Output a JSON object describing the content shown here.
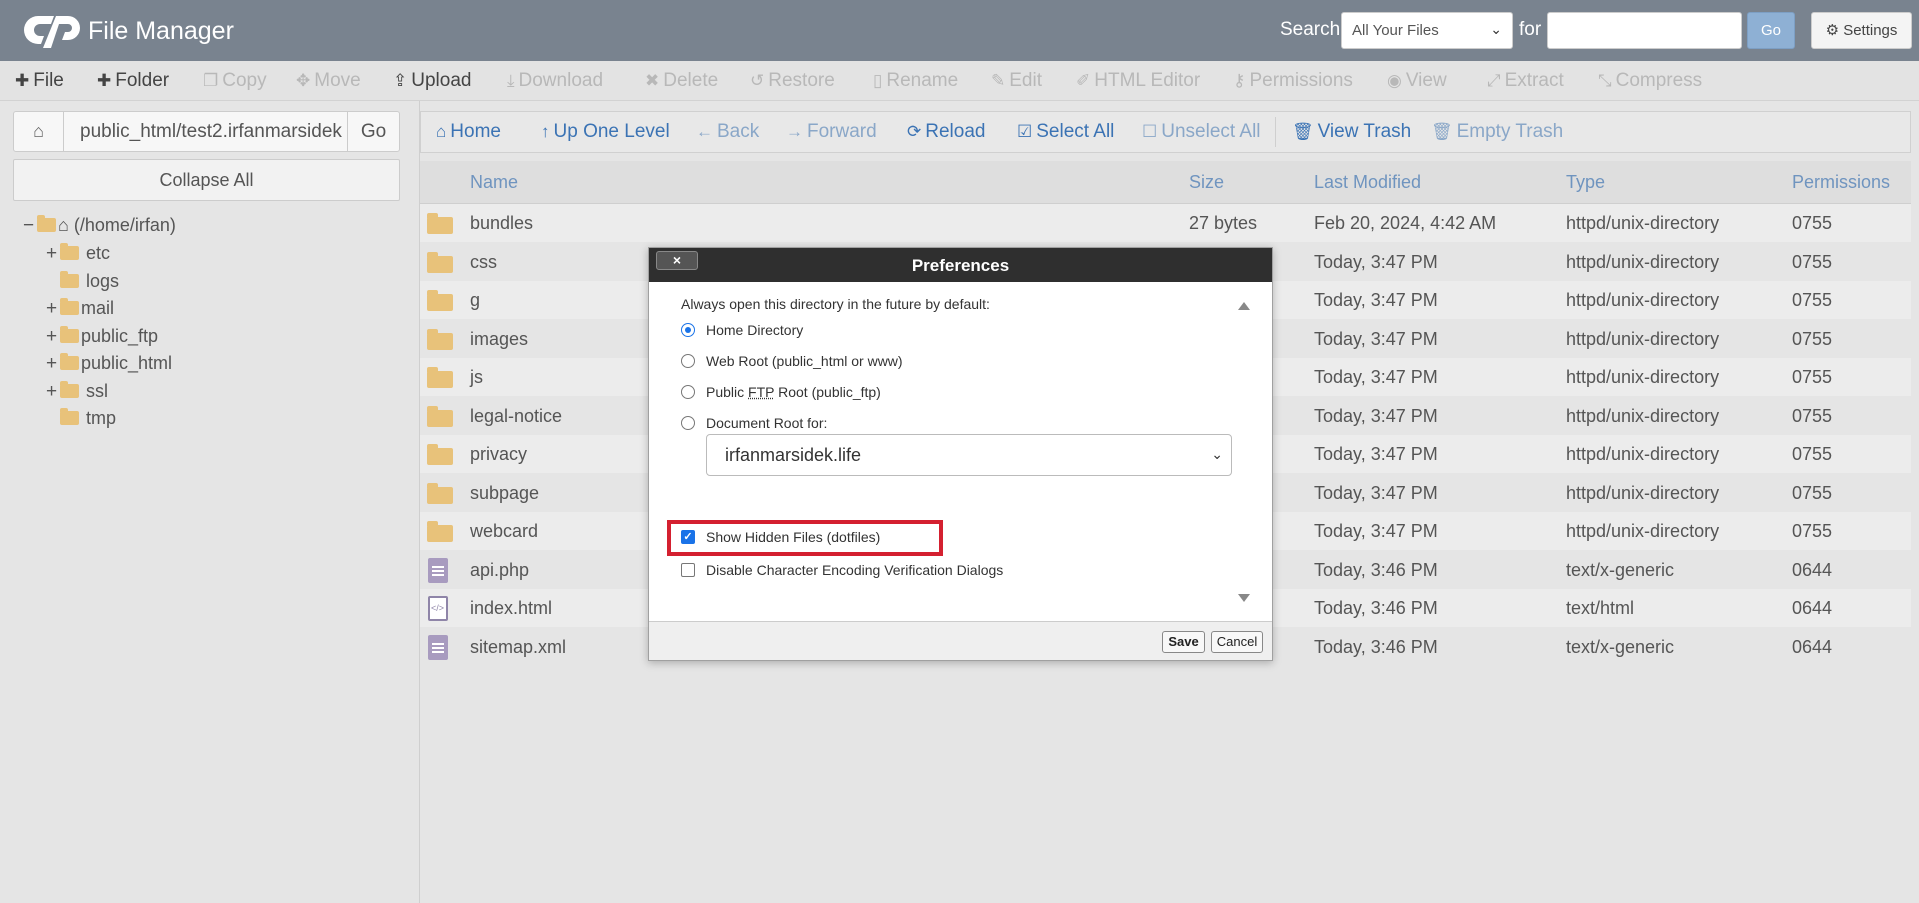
{
  "header": {
    "app_title": "File Manager",
    "search_label": "Search",
    "search_scope": "All Your Files",
    "for_label": "for",
    "search_value": "",
    "go_label": "Go",
    "settings_label": "Settings"
  },
  "toolbar": {
    "file": "File",
    "folder": "Folder",
    "copy": "Copy",
    "move": "Move",
    "upload": "Upload",
    "download": "Download",
    "delete": "Delete",
    "restore": "Restore",
    "rename": "Rename",
    "edit": "Edit",
    "html_editor": "HTML Editor",
    "permissions": "Permissions",
    "view": "View",
    "extract": "Extract",
    "compress": "Compress"
  },
  "left": {
    "path": "public_html/test2.irfanmarsidek",
    "go_label": "Go",
    "collapse_label": "Collapse All",
    "tree_root": "(/home/irfan)",
    "tree": [
      "etc",
      "logs",
      "mail",
      "public_ftp",
      "public_html",
      "ssl",
      "tmp"
    ]
  },
  "nav": {
    "home": "Home",
    "up": "Up One Level",
    "back": "Back",
    "forward": "Forward",
    "reload": "Reload",
    "select_all": "Select All",
    "unselect_all": "Unselect All",
    "view_trash": "View Trash",
    "empty_trash": "Empty Trash"
  },
  "table": {
    "headers": {
      "name": "Name",
      "size": "Size",
      "modified": "Last Modified",
      "type": "Type",
      "perms": "Permissions"
    },
    "rows": [
      {
        "name": "bundles",
        "size": "27 bytes",
        "modified": "Feb 20, 2024, 4:42 AM",
        "type": "httpd/unix-directory",
        "perms": "0755"
      },
      {
        "name": "css",
        "size": "",
        "modified": "Today, 3:47 PM",
        "type": "httpd/unix-directory",
        "perms": "0755"
      },
      {
        "name": "g",
        "size": "",
        "modified": "Today, 3:47 PM",
        "type": "httpd/unix-directory",
        "perms": "0755"
      },
      {
        "name": "images",
        "size": "",
        "modified": "Today, 3:47 PM",
        "type": "httpd/unix-directory",
        "perms": "0755"
      },
      {
        "name": "js",
        "size": "",
        "modified": "Today, 3:47 PM",
        "type": "httpd/unix-directory",
        "perms": "0755"
      },
      {
        "name": "legal-notice",
        "size": "",
        "modified": "Today, 3:47 PM",
        "type": "httpd/unix-directory",
        "perms": "0755"
      },
      {
        "name": "privacy",
        "size": "",
        "modified": "Today, 3:47 PM",
        "type": "httpd/unix-directory",
        "perms": "0755"
      },
      {
        "name": "subpage",
        "size": "",
        "modified": "Today, 3:47 PM",
        "type": "httpd/unix-directory",
        "perms": "0755"
      },
      {
        "name": "webcard",
        "size": "",
        "modified": "Today, 3:47 PM",
        "type": "httpd/unix-directory",
        "perms": "0755"
      },
      {
        "name": "api.php",
        "size": "",
        "modified": "Today, 3:46 PM",
        "type": "text/x-generic",
        "perms": "0644"
      },
      {
        "name": "index.html",
        "size": "",
        "modified": "Today, 3:46 PM",
        "type": "text/html",
        "perms": "0644"
      },
      {
        "name": "sitemap.xml",
        "size": "",
        "modified": "Today, 3:46 PM",
        "type": "text/x-generic",
        "perms": "0644"
      }
    ]
  },
  "dialog": {
    "close_label": "×",
    "title": "Preferences",
    "intro": "Always open this directory in the future by default:",
    "opt_home": "Home Directory",
    "opt_webroot": "Web Root (public_html or www)",
    "opt_ftp_pre": "Public ",
    "opt_ftp_abbr": "FTP",
    "opt_ftp_post": " Root (public_ftp)",
    "opt_docroot": "Document Root for:",
    "docroot_value": "irfanmarsidek.life",
    "show_hidden": "Show Hidden Files (dotfiles)",
    "disable_encoding": "Disable Character Encoding Verification Dialogs",
    "save_label": "Save",
    "cancel_label": "Cancel"
  },
  "colors": {
    "header_bg": "#79838f",
    "link_blue": "#3b73b4",
    "folder": "#e8c27a",
    "highlight": "#d42030"
  }
}
